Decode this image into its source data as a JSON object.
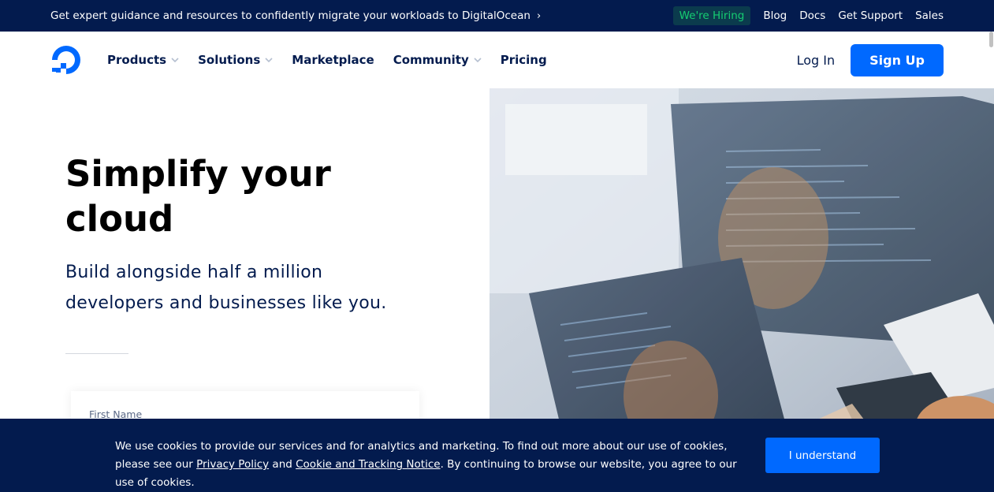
{
  "topbar": {
    "promo_text": "Get expert guidance and resources to confidently migrate your workloads to DigitalOcean",
    "promo_icon": "chevron-right-icon",
    "hiring_label": "We're Hiring",
    "links": [
      "Blog",
      "Docs",
      "Get Support",
      "Sales"
    ]
  },
  "nav": {
    "logo_icon": "digitalocean-logo-icon",
    "menu": [
      {
        "label": "Products",
        "has_dropdown": true
      },
      {
        "label": "Solutions",
        "has_dropdown": true
      },
      {
        "label": "Marketplace",
        "has_dropdown": false
      },
      {
        "label": "Community",
        "has_dropdown": true
      },
      {
        "label": "Pricing",
        "has_dropdown": false
      }
    ],
    "login_label": "Log In",
    "signup_label": "Sign Up"
  },
  "hero": {
    "headline": "Simplify your cloud",
    "subhead": "Build alongside half a million developers and businesses like you.",
    "form": {
      "first_name_label": "First Name"
    }
  },
  "cookie_banner": {
    "text_before": "We use cookies to provide our services and for analytics and marketing. To find out more about our use of cookies, please see our ",
    "privacy_link": "Privacy Policy",
    "text_and": " and ",
    "cookie_link": "Cookie and Tracking Notice",
    "text_after": ". By continuing to browse our website, you agree to our use of cookies.",
    "button_label": "I understand"
  },
  "colors": {
    "navy": "#031b4e",
    "brand_blue": "#0069ff",
    "hiring_green": "#15cd72"
  }
}
